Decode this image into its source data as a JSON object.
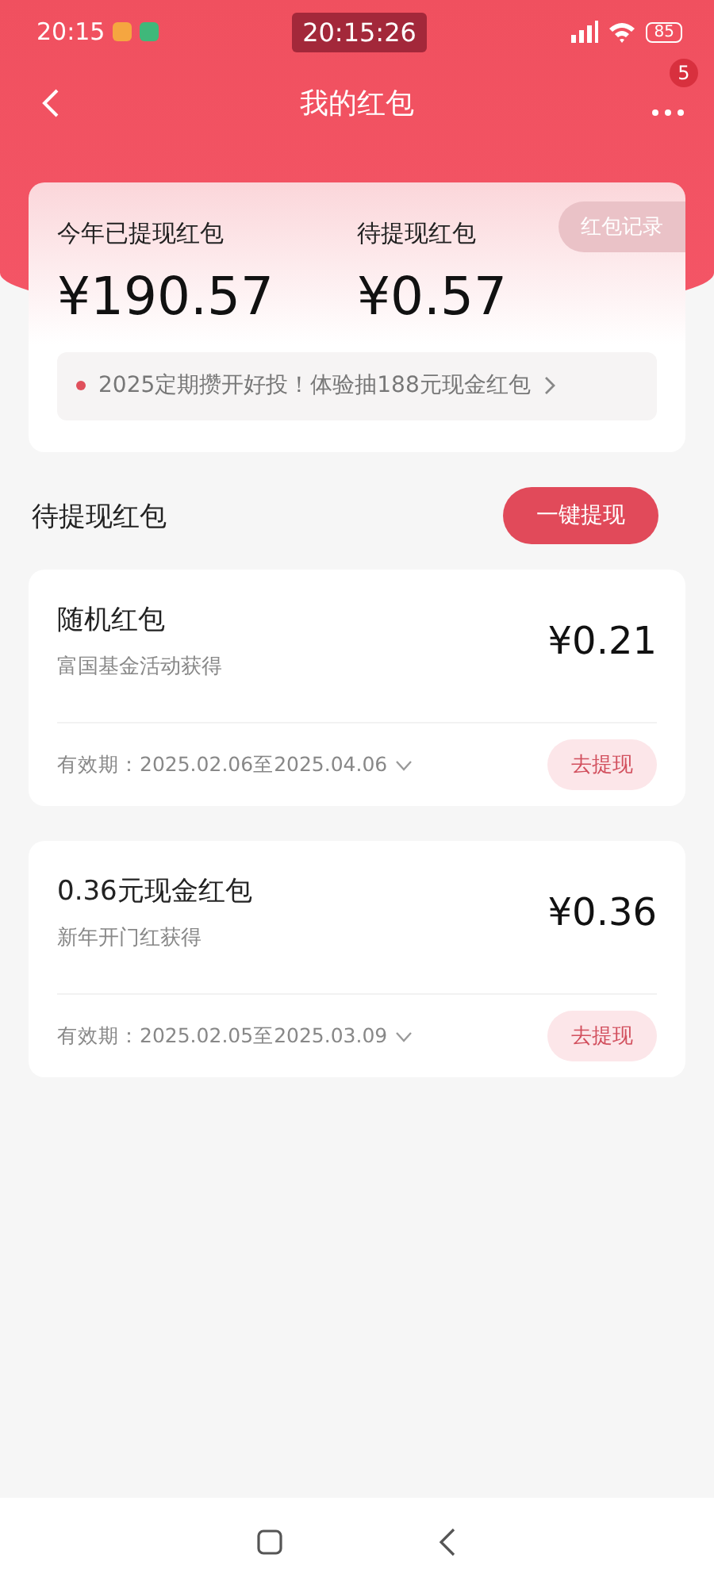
{
  "status_bar": {
    "time": "20:15",
    "clock_badge": "20:15:26",
    "battery": "85"
  },
  "header": {
    "title": "我的红包",
    "badge": "5"
  },
  "summary": {
    "record_button": "红包记录",
    "stats": [
      {
        "label": "今年已提现红包",
        "amount": "¥190.57"
      },
      {
        "label": "待提现红包",
        "amount": "¥0.57"
      }
    ],
    "notice": "2025定期攒开好投！体验抽188元现金红包"
  },
  "section": {
    "title": "待提现红包",
    "action": "一键提现"
  },
  "packets": [
    {
      "name": "随机红包",
      "source": "富国基金活动获得",
      "amount": "¥0.21",
      "validity": "有效期：2025.02.06至2025.04.06",
      "button": "去提现"
    },
    {
      "name": "0.36元现金红包",
      "source": "新年开门红获得",
      "amount": "¥0.36",
      "validity": "有效期：2025.02.05至2025.03.09",
      "button": "去提现"
    }
  ]
}
